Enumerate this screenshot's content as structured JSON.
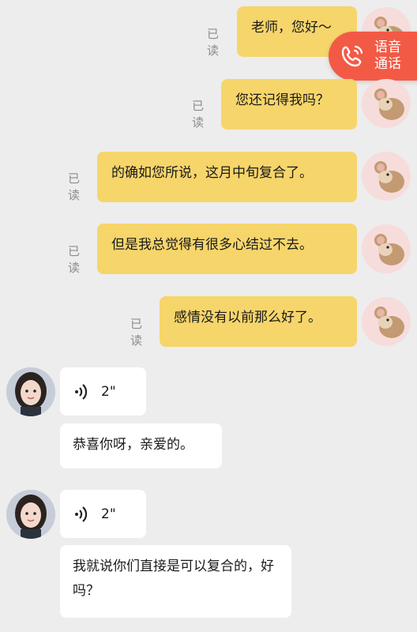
{
  "read_label": "已读",
  "call": {
    "line1": "语音",
    "line2": "通话"
  },
  "outgoing": [
    {
      "text": "老师，您好～"
    },
    {
      "text": "您还记得我吗？"
    },
    {
      "text": "的确如您所说，这月中旬复合了。"
    },
    {
      "text": "但是我总觉得有很多心结过不去。"
    },
    {
      "text": "感情没有以前那么好了。"
    }
  ],
  "incoming": [
    {
      "voice_duration": "2\"",
      "text": "恭喜你呀，亲爱的。"
    },
    {
      "voice_duration": "2\"",
      "text": "我就说你们直接是可以复合的，好吗？"
    }
  ]
}
